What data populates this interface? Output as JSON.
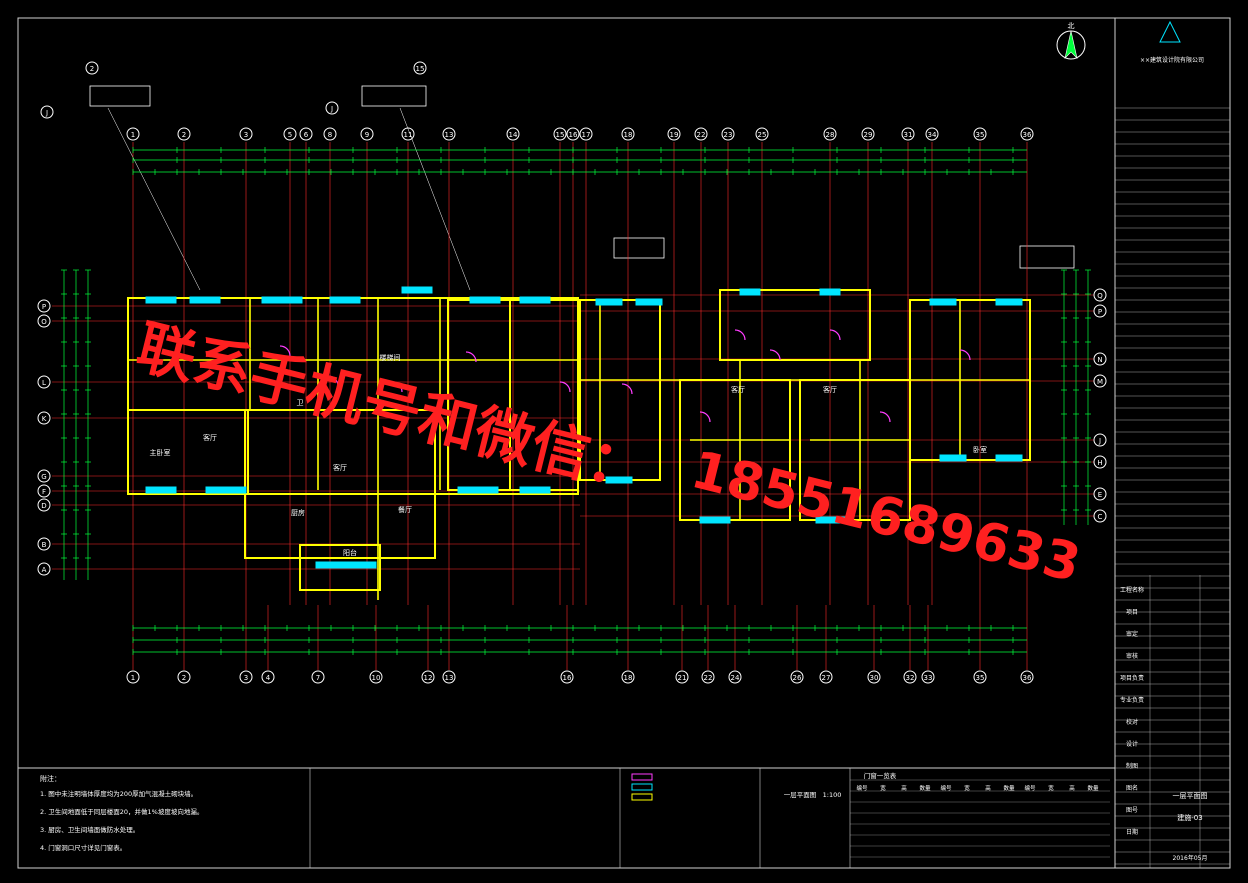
{
  "colors": {
    "background": "#000000",
    "frame": "#d0d0d0",
    "grid_axis": "#ff2a2a",
    "dimension": "#00ff3c",
    "wall": "#ffff00",
    "window": "#00e5ff",
    "door": "#ff3cff",
    "text": "#ffffff",
    "watermark": "#ff1e1e"
  },
  "watermark": {
    "line1": "联系手机号和微信：",
    "line2": "18551689633"
  },
  "grid_columns_top": [
    "1",
    "2",
    "3",
    "5",
    "6",
    "8",
    "9",
    "11",
    "13",
    "14",
    "15",
    "16",
    "17",
    "18",
    "19",
    "22",
    "23",
    "25",
    "28",
    "29",
    "31",
    "34",
    "35",
    "36"
  ],
  "grid_columns_bottom": [
    "1",
    "2",
    "3",
    "4",
    "7",
    "10",
    "12",
    "13",
    "16",
    "18",
    "21",
    "22",
    "24",
    "26",
    "27",
    "30",
    "32",
    "33",
    "35",
    "36"
  ],
  "grid_rows_left": [
    "P",
    "O",
    "L",
    "K",
    "G",
    "F",
    "D",
    "B",
    "A"
  ],
  "grid_rows_right": [
    "Q",
    "P",
    "N",
    "M",
    "J",
    "H",
    "E",
    "C"
  ],
  "detail_markers": {
    "left_callout_top": "2",
    "left_callout_side": "J",
    "mid_callout_top": "15",
    "mid_callout_side": "J"
  },
  "north_arrow": "北",
  "rooms": {
    "living_left": "客厅",
    "bedroom_left": "主卧室",
    "living_mid": "客厅",
    "dining": "餐厅",
    "kitchen": "厨房",
    "bath": "卫",
    "stair": "楼梯间",
    "living_right_a": "客厅",
    "living_right_b": "客厅",
    "bedroom_right": "卧室",
    "balcony": "阳台"
  },
  "title_block": {
    "company": "××建筑设计院有限公司",
    "rows": [
      "工程名称",
      "项目",
      "审定",
      "审核",
      "项目负责",
      "专业负责",
      "校对",
      "设计",
      "制图",
      "图名",
      "图号",
      "日期"
    ],
    "drawing_name": "一层平面图",
    "sheet_no": "建施-03",
    "date": "2016年05月"
  },
  "notes": {
    "header": "附注：",
    "lines": [
      "1. 图中未注明墙体厚度均为200厚加气混凝土砌块墙。",
      "2. 卫生间地面低于同层楼面20，并做1%坡度坡向地漏。",
      "3. 厨房、卫生间墙面做防水处理。",
      "4. 门窗洞口尺寸详见门窗表。"
    ]
  },
  "legend": {
    "title": "一层平面图",
    "scale": "1:100"
  },
  "door_table": {
    "title": "门窗一览表",
    "headers": [
      "编号",
      "宽",
      "高",
      "数量",
      "编号",
      "宽",
      "高",
      "数量",
      "编号",
      "宽",
      "高",
      "数量"
    ]
  }
}
